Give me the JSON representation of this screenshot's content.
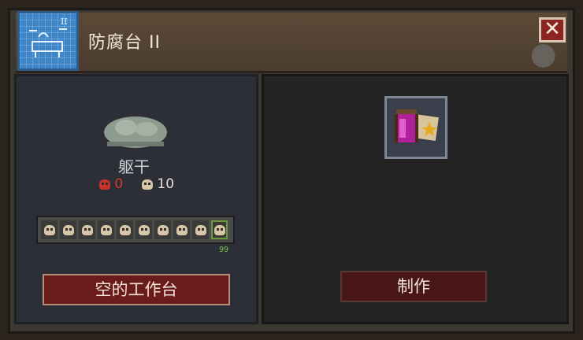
{
  "window": {
    "title": "防腐台 II"
  },
  "ingredient": {
    "name": "躯干",
    "red_skull_count": "0",
    "skull_count": "10"
  },
  "slots": {
    "count_label": "99",
    "filled": 10
  },
  "buttons": {
    "empty_workbench": "空的工作台",
    "craft": "制作",
    "close": "✕"
  },
  "colors": {
    "accent_red": "#8e2422",
    "blueprint_blue": "#3f86c8",
    "slot_green": "#7ac04a"
  },
  "icons": {
    "title_icon": "blueprint-icon",
    "ingredient_icon": "mummy-torso-icon",
    "product_icon": "potion-jar-icon",
    "slot_icon": "skull-icon"
  }
}
